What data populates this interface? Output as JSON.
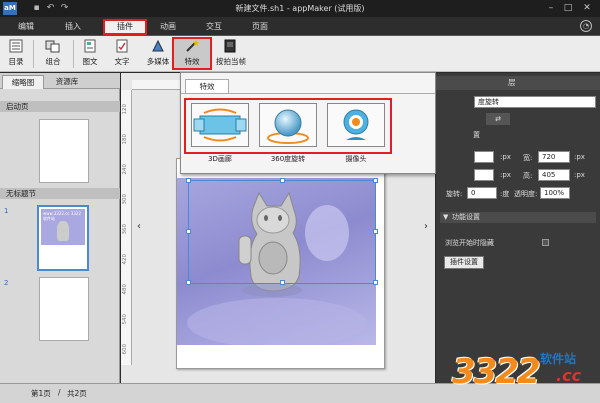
{
  "window": {
    "title": "新建文件.sh1 - appMaker (试用版)",
    "logo": "aM"
  },
  "menu": {
    "tabs": [
      {
        "label": "编辑"
      },
      {
        "label": "插入"
      },
      {
        "label": "插件",
        "active": true
      },
      {
        "label": "动画"
      },
      {
        "label": "交互"
      },
      {
        "label": "页面"
      }
    ]
  },
  "ribbon": {
    "toc": "目录",
    "group": "组合",
    "text_image": "图文",
    "text": "文字",
    "multimedia": "多媒体",
    "effects": "特效",
    "recorder": "按拍当帧"
  },
  "left_panel": {
    "tabs": [
      "缩略图",
      "资源库"
    ],
    "start_page": "启动页",
    "chapter": "无标题节",
    "page_numbers": [
      "1",
      "2"
    ],
    "thumb_caption": "www.3322.cc 3322软件站"
  },
  "popup": {
    "tab": "特效",
    "effects": [
      {
        "label": "3D画廊",
        "icon": "3d-gallery-icon"
      },
      {
        "label": "360度旋转",
        "icon": "sphere-rotate-icon"
      },
      {
        "label": "摄像头",
        "icon": "webcam-icon"
      }
    ]
  },
  "right_panel": {
    "header": "层",
    "layer_name": "度旋转",
    "section_partial": "置",
    "unit": ":px",
    "width_label": "宽:",
    "width_value": "720",
    "height_label": "高:",
    "height_value": "405",
    "rotate_label": "旋转:",
    "rotate_value": "0",
    "deg_unit": ":度",
    "opacity_label": "透明度:",
    "opacity_value": "100%",
    "function_section": "功能设置",
    "hide_on_start": "浏览开始时隐藏",
    "plugin_settings": "插件设置"
  },
  "status": {
    "page": "第1页",
    "separator": "/",
    "total": "共2页"
  },
  "ruler": {
    "v_labels": [
      "120",
      "180",
      "240",
      "300",
      "360",
      "420",
      "480",
      "540",
      "600"
    ]
  },
  "watermark": {
    "digits": "3322",
    "site": "软件站",
    "domain": ".cc"
  },
  "colors": {
    "highlight": "#e02020",
    "selection": "#4a8ad4",
    "photo_bg": "#a7a6df"
  }
}
